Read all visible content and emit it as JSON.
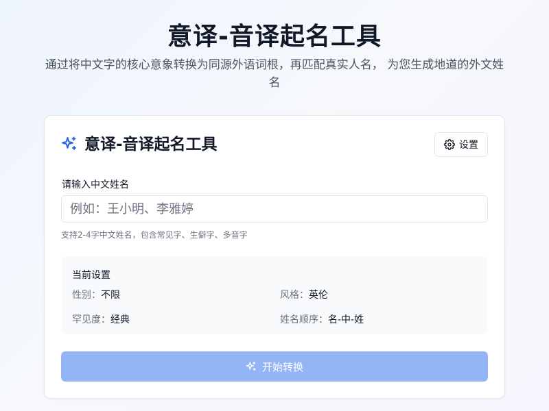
{
  "hero": {
    "title": "意译-音译起名工具",
    "subtitle": "通过将中文字的核心意象转换为同源外语词根，再匹配真实人名， 为您生成地道的外文姓名"
  },
  "card": {
    "title": "意译-音译起名工具",
    "title_icon": "sparkles-icon",
    "settings_button": {
      "label": "设置",
      "icon": "gear-icon"
    },
    "input": {
      "label": "请输入中文姓名",
      "value": "",
      "placeholder": "例如：王小明、李雅婷",
      "hint": "支持2-4字中文姓名，包含常见字、生僻字、多音字"
    },
    "current_settings": {
      "title": "当前设置",
      "items": [
        {
          "key": "性别：",
          "value": "不限"
        },
        {
          "key": "风格：",
          "value": "英伦"
        },
        {
          "key": "罕见度：",
          "value": "经典"
        },
        {
          "key": "姓名顺序：",
          "value": "名-中-姓"
        }
      ]
    },
    "start_button": {
      "label": "开始转换",
      "icon": "sparkles-icon",
      "disabled": true
    }
  },
  "colors": {
    "accent": "#2563eb",
    "button_disabled": "#93b4f5",
    "text_primary": "#111827",
    "text_muted": "#6b7280"
  }
}
